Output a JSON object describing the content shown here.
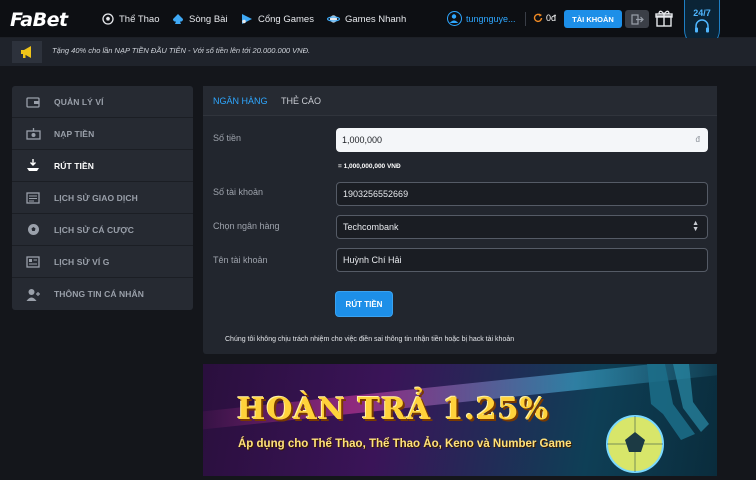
{
  "header": {
    "logo": "FaBet",
    "nav": [
      {
        "label": "Thể Thao",
        "icon": "soccer-ball-icon"
      },
      {
        "label": "Sòng Bài",
        "icon": "spade-icon"
      },
      {
        "label": "Cổng Games",
        "icon": "play-icon"
      },
      {
        "label": "Games Nhanh",
        "icon": "planet-icon"
      }
    ],
    "username": "tungnguye...",
    "balance": "0đ",
    "account_button": "TÀI KHOẢN",
    "support_label": "24/7"
  },
  "promo": {
    "text": "Tặng 40% cho lần NẠP TIỀN ĐẦU TIÊN - Với số tiền lên tới 20.000.000 VNĐ."
  },
  "sidebar": {
    "items": [
      {
        "label": "QUẢN LÝ VÍ",
        "icon": "wallet-icon"
      },
      {
        "label": "NẠP TIỀN",
        "icon": "deposit-icon"
      },
      {
        "label": "RÚT TIỀN",
        "icon": "withdraw-icon"
      },
      {
        "label": "LỊCH SỬ GIAO DỊCH",
        "icon": "history-icon"
      },
      {
        "label": "LỊCH SỬ CÁ CƯỢC",
        "icon": "ball-icon"
      },
      {
        "label": "LỊCH SỬ VÍ G",
        "icon": "ledger-icon"
      },
      {
        "label": "THÔNG TIN CÁ NHÂN",
        "icon": "user-icon"
      }
    ],
    "active_index": 2
  },
  "form": {
    "tabs": [
      "NGÂN HÀNG",
      "THẺ CÀO"
    ],
    "amount_label": "Số tiền",
    "amount_value": "1,000,000",
    "amount_unit": "đ",
    "amount_equivalent": "= 1,000,000,000 VNĐ",
    "account_number_label": "Số tài khoản",
    "account_number_value": "1903256552669",
    "bank_label": "Chọn ngân hàng",
    "bank_value": "Techcombank",
    "account_name_label": "Tên tài khoản",
    "account_name_value": "Huỳnh Chí Hải",
    "submit_label": "RÚT TIỀN",
    "disclaimer": "Chúng tôi không chịu trách nhiệm cho việc điền sai thông tin nhận tiền hoặc bị hack tài khoản"
  },
  "banner": {
    "headline": "HOÀN TRẢ 1.25%",
    "subline": "Áp dụng cho Thể Thao, Thể Thao Ảo, Keno và Number Game"
  },
  "colors": {
    "accent": "#1d8fe8",
    "link_blue": "#2ea7ff",
    "background": "#14161b",
    "panel": "#22262e"
  }
}
